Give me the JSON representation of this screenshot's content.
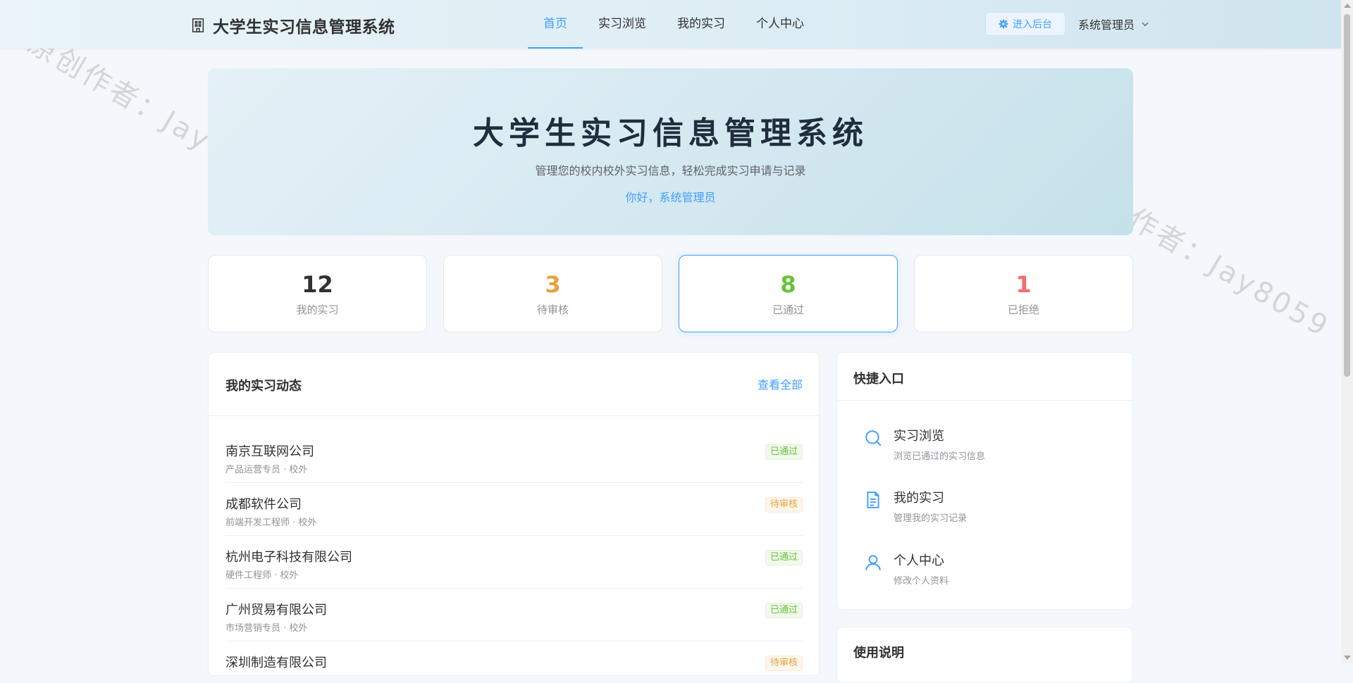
{
  "header": {
    "brand_title": "大学生实习信息管理系统",
    "nav": [
      {
        "label": "首页",
        "active": true
      },
      {
        "label": "实习浏览",
        "active": false
      },
      {
        "label": "我的实习",
        "active": false
      },
      {
        "label": "个人中心",
        "active": false
      }
    ],
    "admin_button": "进入后台",
    "user_name": "系统管理员"
  },
  "hero": {
    "title": "大学生实习信息管理系统",
    "subtitle": "管理您的校内校外实习信息，轻松完成实习申请与记录",
    "greeting": "你好，系统管理员"
  },
  "stats": [
    {
      "value": "12",
      "label": "我的实习",
      "color": "#303133"
    },
    {
      "value": "3",
      "label": "待审核",
      "color": "#e6a23c"
    },
    {
      "value": "8",
      "label": "已通过",
      "color": "#67c23a"
    },
    {
      "value": "1",
      "label": "已拒绝",
      "color": "#f56c6c"
    }
  ],
  "activity": {
    "title": "我的实习动态",
    "view_all": "查看全部",
    "items": [
      {
        "company": "南京互联网公司",
        "meta": "产品运营专员 · 校外",
        "status": "已通过",
        "status_type": "ok"
      },
      {
        "company": "成都软件公司",
        "meta": "前端开发工程师 · 校外",
        "status": "待审核",
        "status_type": "pending"
      },
      {
        "company": "杭州电子科技有限公司",
        "meta": "硬件工程师 · 校外",
        "status": "已通过",
        "status_type": "ok"
      },
      {
        "company": "广州贸易有限公司",
        "meta": "市场营销专员 · 校外",
        "status": "已通过",
        "status_type": "ok"
      },
      {
        "company": "深圳制造有限公司",
        "meta": "",
        "status": "待审核",
        "status_type": "pending"
      }
    ]
  },
  "quick": {
    "title": "快捷入口",
    "items": [
      {
        "icon": "search-icon",
        "title": "实习浏览",
        "desc": "浏览已通过的实习信息"
      },
      {
        "icon": "document-icon",
        "title": "我的实习",
        "desc": "管理我的实习记录"
      },
      {
        "icon": "user-icon",
        "title": "个人中心",
        "desc": "修改个人资料"
      }
    ]
  },
  "usage": {
    "title": "使用说明"
  },
  "watermark_text": "原创作者：Jay8059",
  "colors": {
    "accent": "#409eff",
    "success": "#67c23a",
    "warning": "#e6a23c",
    "danger": "#f56c6c"
  }
}
